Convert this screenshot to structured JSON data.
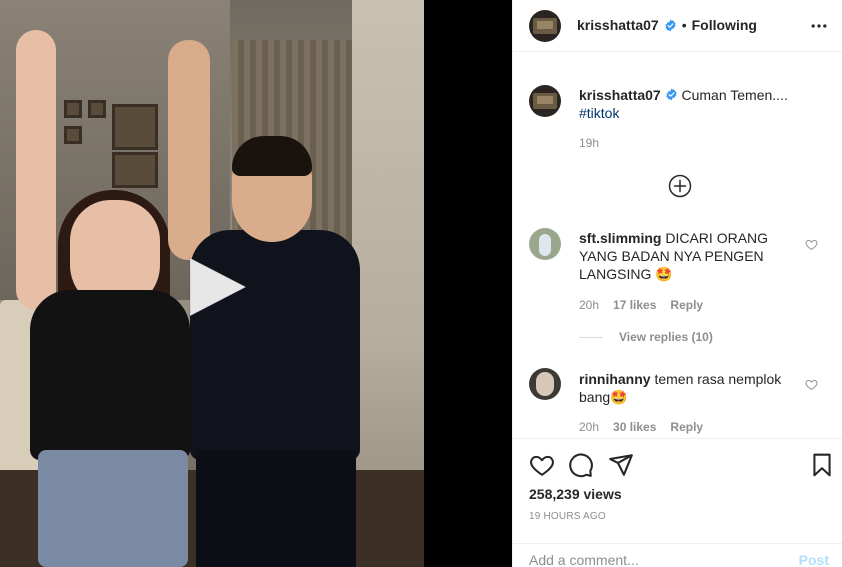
{
  "post": {
    "author": "krisshatta07",
    "follow_separator": "•",
    "follow_status": "Following",
    "caption_text": "Cuman Temen....",
    "caption_hashtag": "#tiktok",
    "caption_time": "19h"
  },
  "comments": [
    {
      "username": "sft.slimming",
      "text_lines": [
        "DICARI ORANG",
        "YANG BADAN NYA PENGEN",
        "LANGSING 🤩"
      ],
      "time": "20h",
      "likes": "17 likes",
      "reply_label": "Reply",
      "view_replies": "View replies (10)"
    },
    {
      "username": "rinnihanny",
      "text_lines": [
        "temen rasa nemplok",
        "bang🤩"
      ],
      "time": "20h",
      "likes": "30 likes",
      "reply_label": "Reply"
    }
  ],
  "stats": {
    "views": "258,239 views",
    "posted": "19 HOURS AGO"
  },
  "comment_box": {
    "placeholder": "Add a comment...",
    "post_label": "Post"
  },
  "icons": {
    "verified": "verified-badge-icon",
    "more": "more-options-icon",
    "load_more": "plus-circle-icon",
    "like": "heart-icon",
    "comment": "comment-bubble-icon",
    "share": "paper-plane-icon",
    "save": "bookmark-icon",
    "play": "play-icon"
  },
  "colors": {
    "verified_blue": "#3897f0",
    "link_blue": "#00376b",
    "post_disabled": "#b2dffc",
    "secondary_text": "#8e8e8e"
  }
}
